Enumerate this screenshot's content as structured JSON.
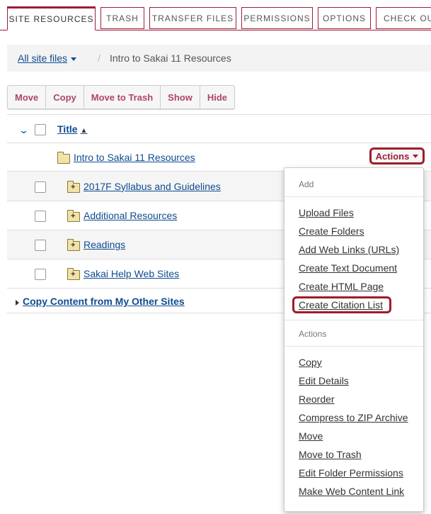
{
  "tabs": [
    {
      "label": "SITE RESOURCES",
      "active": true
    },
    {
      "label": "TRASH"
    },
    {
      "label": "TRANSFER FILES"
    },
    {
      "label": "PERMISSIONS"
    },
    {
      "label": "OPTIONS"
    },
    {
      "label": "CHECK OU"
    }
  ],
  "breadcrumb": {
    "root": "All site files",
    "separator": "/",
    "current": "Intro to Sakai 11 Resources"
  },
  "toolbar": [
    "Move",
    "Copy",
    "Move to Trash",
    "Show",
    "Hide"
  ],
  "table": {
    "title_header": "Title",
    "parent_folder": "Intro to Sakai 11 Resources",
    "actions_label": "Actions",
    "rows": [
      "2017F Syllabus and Guidelines",
      "Additional Resources",
      "Readings",
      "Sakai Help Web Sites"
    ],
    "copy_content": "Copy Content from My Other Sites"
  },
  "dropdown": {
    "add_header": "Add",
    "add_items": [
      "Upload Files",
      "Create Folders",
      "Add Web Links (URLs)",
      "Create Text Document",
      "Create HTML Page",
      "Create Citation List"
    ],
    "actions_header": "Actions",
    "action_items": [
      "Copy",
      "Edit Details",
      "Reorder",
      "Compress to ZIP Archive",
      "Move",
      "Move to Trash",
      "Edit Folder Permissions",
      "Make Web Content Link"
    ]
  },
  "colors": {
    "accent": "#9e1c3a",
    "link": "#0f4b8f",
    "button_text": "#b04565"
  }
}
